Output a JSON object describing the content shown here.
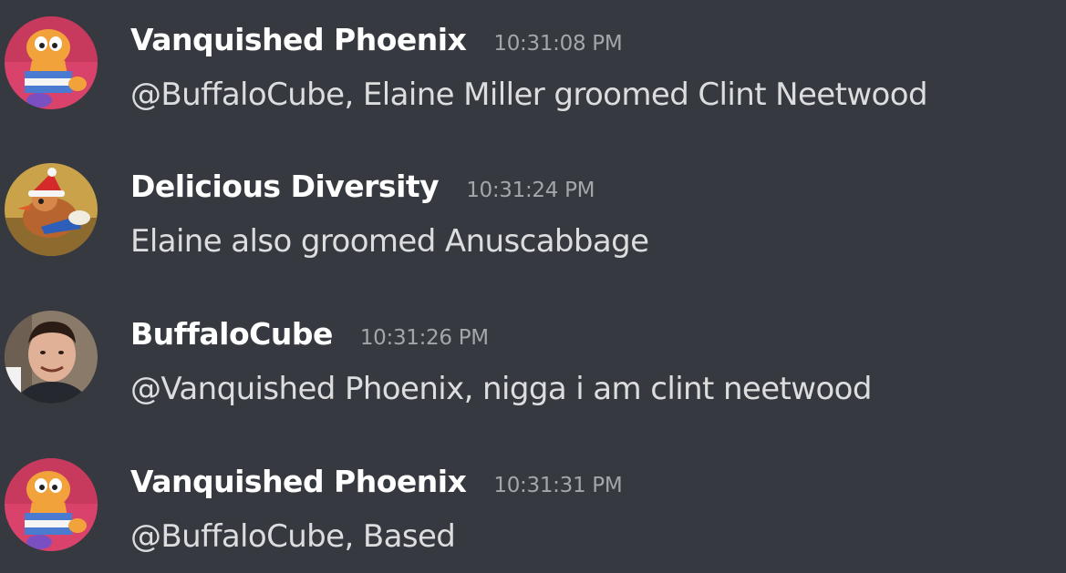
{
  "messages": [
    {
      "author": "Vanquished Phoenix",
      "timestamp": "10:31:08 PM",
      "text": "@BuffaloCube, Elaine Miller groomed Clint Neetwood",
      "avatar_icon": "cartoon-cat-avatar-icon"
    },
    {
      "author": "Delicious Diversity",
      "timestamp": "10:31:24 PM",
      "text": "Elaine also groomed Anuscabbage",
      "avatar_icon": "duck-santa-hat-avatar-icon"
    },
    {
      "author": "BuffaloCube",
      "timestamp": "10:31:26 PM",
      "text": "@Vanquished Phoenix, nigga i am clint neetwood",
      "avatar_icon": "man-photo-avatar-icon"
    },
    {
      "author": "Vanquished Phoenix",
      "timestamp": "10:31:31 PM",
      "text": "@BuffaloCube, Based",
      "avatar_icon": "cartoon-cat-avatar-icon"
    }
  ],
  "colors": {
    "background": "#36393f",
    "username": "#ffffff",
    "timestamp": "#a3a6aa",
    "message_text": "#dcddde"
  }
}
